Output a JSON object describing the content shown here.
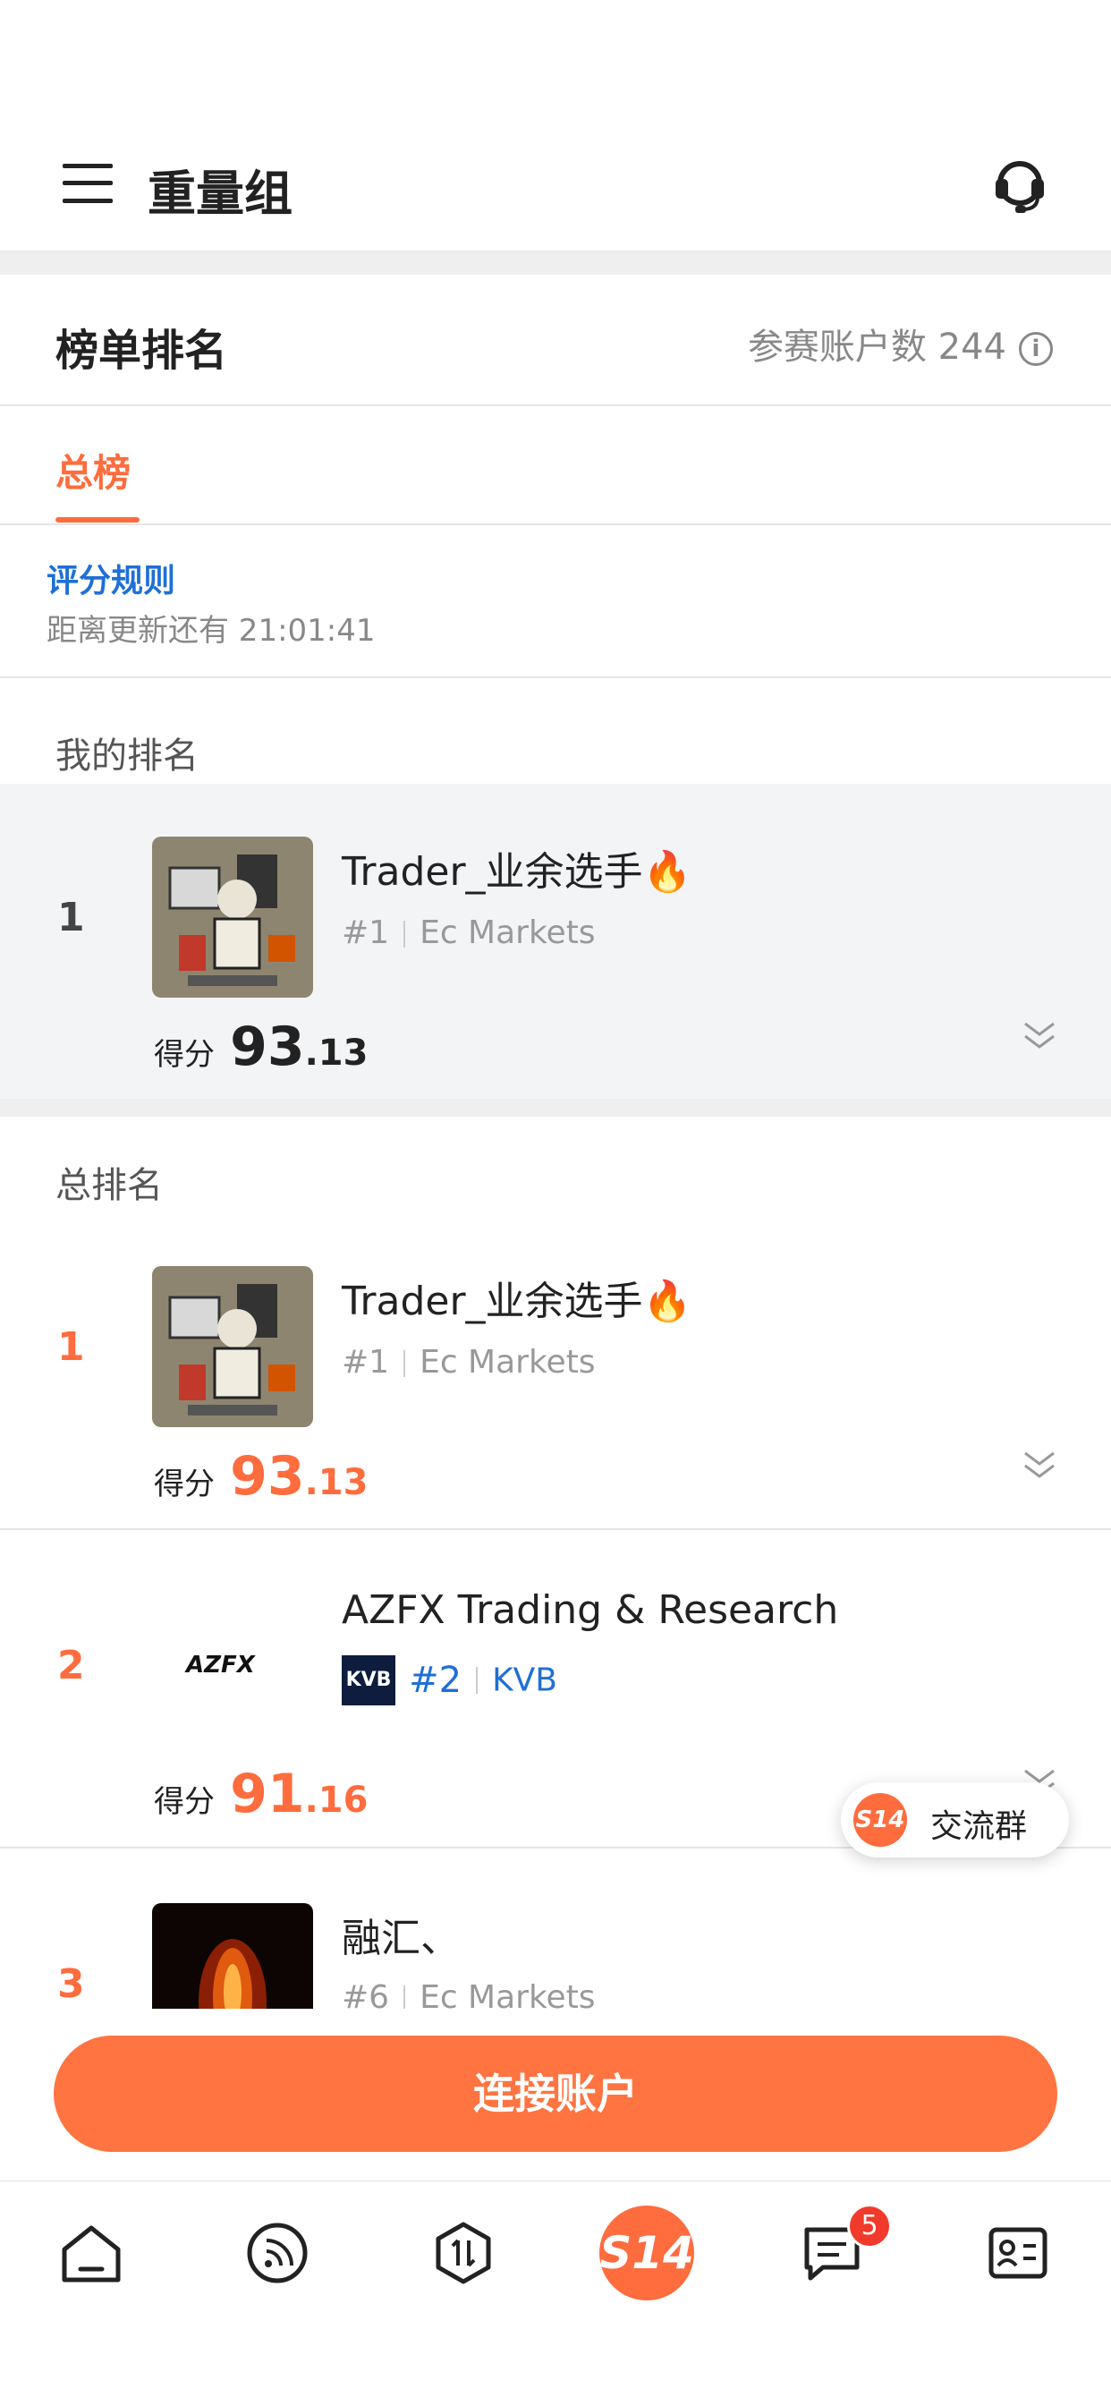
{
  "header": {
    "title": "重量组",
    "menu_icon": "menu-icon",
    "support_icon": "headset-icon"
  },
  "board": {
    "title": "榜单排名",
    "participants_label": "参赛账户数 244",
    "info_icon": "i",
    "tab_active": "总榜",
    "rules_link": "评分规则",
    "countdown": "距离更新还有 21:01:41"
  },
  "my_rank": {
    "section_label": "我的排名",
    "rank": "1",
    "name": "Trader_业余选手",
    "fire": "🔥",
    "position": "#1",
    "broker": "Ec Markets",
    "score_label": "得分",
    "score_int": "93",
    "score_dec": ".13"
  },
  "overall": {
    "section_label": "总排名",
    "rows": [
      {
        "rank": "1",
        "name": "Trader_业余选手",
        "fire": "🔥",
        "position": "#1",
        "broker": "Ec Markets",
        "score_label": "得分",
        "score_int": "93",
        "score_dec": ".13"
      },
      {
        "rank": "2",
        "name": "AZFX Trading & Research",
        "logo_text": "AZFX",
        "badge": "KVB",
        "position": "#2",
        "broker": "KVB",
        "score_label": "得分",
        "score_int": "91",
        "score_dec": ".16"
      },
      {
        "rank": "3",
        "name": "融汇、",
        "position": "#6",
        "broker": "Ec Markets"
      }
    ]
  },
  "float_chat": {
    "badge": "S14",
    "label": "交流群"
  },
  "connect_button": "连接账户",
  "bottom_nav": {
    "s14": "S14",
    "message_badge": "5",
    "items": [
      "home-icon",
      "feed-icon",
      "trade-icon",
      "s14-icon",
      "message-icon",
      "profile-icon"
    ]
  },
  "colors": {
    "accent": "#ff6c3d",
    "link": "#1f6fd6",
    "kvb": "#0e1c3d"
  }
}
